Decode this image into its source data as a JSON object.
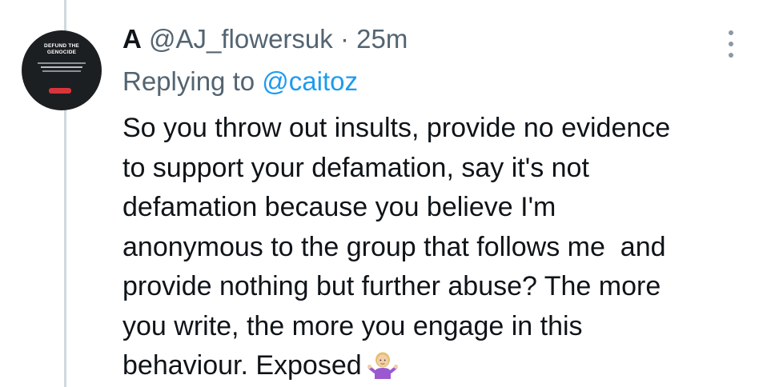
{
  "tweet": {
    "display_name": "A",
    "handle": "@AJ_flowersuk",
    "separator": "·",
    "time": "25m",
    "reply_prefix": "Replying to",
    "reply_mention": "@caitoz",
    "text_lines": [
      "So you throw out insults, provide no evidence",
      "to support your defamation, say it's not",
      "defamation because you believe I'm",
      "anonymous to the group that follows me  and",
      "provide nothing but further abuse? The more",
      "you write, the more you engage in this",
      "behaviour. Exposed"
    ],
    "emoji_icon": "person-shrugging-emoji"
  },
  "avatar": {
    "title_line1": "DEFUND THE",
    "title_line2": "GENOCIDE"
  },
  "colors": {
    "text": "#0f1419",
    "secondary": "#536471",
    "link": "#1d9bf0",
    "thread_line": "#cfd9de"
  }
}
